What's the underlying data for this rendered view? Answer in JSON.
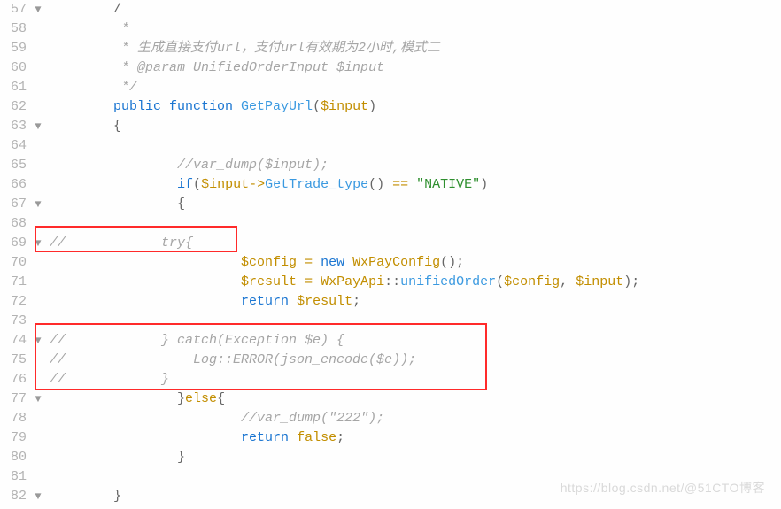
{
  "watermark": "https://blog.csdn.net/@51CTO博客",
  "indent": "        ",
  "lines": [
    {
      "n": "57",
      "fold": "▼",
      "t": [
        {
          "c": "tk-punc",
          "x": "/"
        }
      ],
      "ind": 1
    },
    {
      "n": "58",
      "fold": "",
      "t": [
        {
          "c": "tk-comment",
          "x": " *"
        }
      ],
      "ind": 1
    },
    {
      "n": "59",
      "fold": "",
      "t": [
        {
          "c": "tk-comment",
          "x": " * 生成直接支付url，支付url有效期为2小时,模式二"
        }
      ],
      "ind": 1
    },
    {
      "n": "60",
      "fold": "",
      "t": [
        {
          "c": "tk-comment",
          "x": " * @param UnifiedOrderInput $input"
        }
      ],
      "ind": 1
    },
    {
      "n": "61",
      "fold": "",
      "t": [
        {
          "c": "tk-comment",
          "x": " */"
        }
      ],
      "ind": 1
    },
    {
      "n": "62",
      "fold": "",
      "t": [
        {
          "c": "tk-keyword",
          "x": "public "
        },
        {
          "c": "tk-keyword",
          "x": "function "
        },
        {
          "c": "tk-func",
          "x": "GetPayUrl"
        },
        {
          "c": "tk-punc",
          "x": "("
        },
        {
          "c": "tk-var",
          "x": "$input"
        },
        {
          "c": "tk-punc",
          "x": ")"
        }
      ],
      "ind": 1
    },
    {
      "n": "63",
      "fold": "▼",
      "t": [
        {
          "c": "tk-punc",
          "x": "{"
        }
      ],
      "ind": 1
    },
    {
      "n": "64",
      "fold": "",
      "t": [],
      "ind": 1
    },
    {
      "n": "65",
      "fold": "",
      "t": [
        {
          "c": "tk-comment",
          "x": "//var_dump($input);"
        }
      ],
      "ind": 2
    },
    {
      "n": "66",
      "fold": "",
      "t": [
        {
          "c": "tk-keyword",
          "x": "if"
        },
        {
          "c": "tk-punc",
          "x": "("
        },
        {
          "c": "tk-var",
          "x": "$input"
        },
        {
          "c": "tk-op",
          "x": "->"
        },
        {
          "c": "tk-func",
          "x": "GetTrade_type"
        },
        {
          "c": "tk-punc",
          "x": "()"
        },
        {
          "c": "tk-op",
          "x": " == "
        },
        {
          "c": "tk-str",
          "x": "\"NATIVE\""
        },
        {
          "c": "tk-punc",
          "x": ")"
        }
      ],
      "ind": 2
    },
    {
      "n": "67",
      "fold": "▼",
      "t": [
        {
          "c": "tk-punc",
          "x": "{"
        }
      ],
      "ind": 2
    },
    {
      "n": "68",
      "fold": "",
      "t": [],
      "ind": 2
    },
    {
      "n": "69",
      "fold": "▼",
      "t": [
        {
          "c": "tk-comment",
          "x": "//            try{"
        }
      ],
      "ind": 0
    },
    {
      "n": "70",
      "fold": "",
      "t": [
        {
          "c": "tk-var",
          "x": "$config"
        },
        {
          "c": "tk-op",
          "x": " = "
        },
        {
          "c": "tk-keyword",
          "x": "new "
        },
        {
          "c": "tk-type",
          "x": "WxPayConfig"
        },
        {
          "c": "tk-punc",
          "x": "();"
        }
      ],
      "ind": 3
    },
    {
      "n": "71",
      "fold": "",
      "t": [
        {
          "c": "tk-var",
          "x": "$result"
        },
        {
          "c": "tk-op",
          "x": " = "
        },
        {
          "c": "tk-type",
          "x": "WxPayApi"
        },
        {
          "c": "tk-punc",
          "x": "::"
        },
        {
          "c": "tk-func",
          "x": "unifiedOrder"
        },
        {
          "c": "tk-punc",
          "x": "("
        },
        {
          "c": "tk-var",
          "x": "$config"
        },
        {
          "c": "tk-punc",
          "x": ", "
        },
        {
          "c": "tk-var",
          "x": "$input"
        },
        {
          "c": "tk-punc",
          "x": ");"
        }
      ],
      "ind": 3
    },
    {
      "n": "72",
      "fold": "",
      "t": [
        {
          "c": "tk-keyword",
          "x": "return "
        },
        {
          "c": "tk-var",
          "x": "$result"
        },
        {
          "c": "tk-punc",
          "x": ";"
        }
      ],
      "ind": 3
    },
    {
      "n": "73",
      "fold": "",
      "t": [],
      "ind": 3
    },
    {
      "n": "74",
      "fold": "▼",
      "t": [
        {
          "c": "tk-comment",
          "x": "//            } catch(Exception $e) {"
        }
      ],
      "ind": 0
    },
    {
      "n": "75",
      "fold": "",
      "t": [
        {
          "c": "tk-comment",
          "x": "//                Log::ERROR(json_encode($e));"
        }
      ],
      "ind": 0
    },
    {
      "n": "76",
      "fold": "",
      "t": [
        {
          "c": "tk-comment",
          "x": "//            }"
        }
      ],
      "ind": 0
    },
    {
      "n": "77",
      "fold": "▼",
      "t": [
        {
          "c": "tk-punc",
          "x": "}"
        },
        {
          "c": "tk-else",
          "x": "else"
        },
        {
          "c": "tk-punc",
          "x": "{"
        }
      ],
      "ind": 2
    },
    {
      "n": "78",
      "fold": "",
      "t": [
        {
          "c": "tk-comment",
          "x": "//var_dump(\"222\");"
        }
      ],
      "ind": 3
    },
    {
      "n": "79",
      "fold": "",
      "t": [
        {
          "c": "tk-keyword",
          "x": "return "
        },
        {
          "c": "tk-false",
          "x": "false"
        },
        {
          "c": "tk-punc",
          "x": ";"
        }
      ],
      "ind": 3
    },
    {
      "n": "80",
      "fold": "",
      "t": [
        {
          "c": "tk-punc",
          "x": "}"
        }
      ],
      "ind": 2
    },
    {
      "n": "81",
      "fold": "",
      "t": [],
      "ind": 2
    },
    {
      "n": "82",
      "fold": "▼",
      "t": [
        {
          "c": "tk-punc",
          "x": "}"
        }
      ],
      "ind": 1
    }
  ]
}
